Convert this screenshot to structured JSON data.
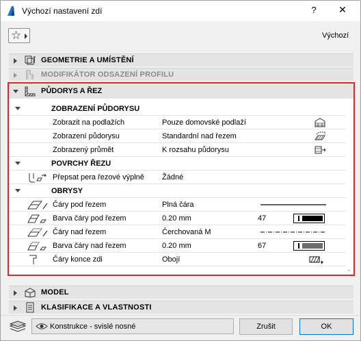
{
  "window": {
    "title": "Výchozí nastavení zdí",
    "help_label": "?",
    "close_label": "✕",
    "default_label": "Výchozí"
  },
  "panels": {
    "geometry": "GEOMETRIE A UMÍSTĚNÍ",
    "offset": "MODIFIKÁTOR ODSAZENÍ PROFILU",
    "plan_section": "PŮDORYS A ŘEZ",
    "model": "MODEL",
    "classification": "KLASIFIKACE A VLASTNOSTI"
  },
  "groups": {
    "plan_display": "ZOBRAZENÍ PŮDORYSU",
    "cut_surfaces": "POVRCHY ŘEZU",
    "outlines": "OBRYSY"
  },
  "rows": {
    "show_on_stories": {
      "label": "Zobrazit na podlažích",
      "value": "Pouze domovské podlaží"
    },
    "floor_plan_display": {
      "label": "Zobrazení půdorysu",
      "value": "Standardní nad řezem"
    },
    "show_projection": {
      "label": "Zobrazený průmět",
      "value": "K rozsahu půdorysu"
    },
    "override_cut_fill": {
      "label": "Přepsat pera řezové výplně",
      "value": "Žádné"
    },
    "uncut_lines": {
      "label": "Čáry pod řezem",
      "value": "Plná čára"
    },
    "uncut_line_pen": {
      "label": "Barva čáry pod řezem",
      "value": "0.20 mm",
      "pen": "47",
      "pen_color": "#000000"
    },
    "overhead_lines": {
      "label": "Čáry nad řezem",
      "value": "Čerchovaná M"
    },
    "overhead_line_pen": {
      "label": "Barva čáry nad řezem",
      "value": "0.20 mm",
      "pen": "67",
      "pen_color": "#6b6b6b"
    },
    "wall_end_lines": {
      "label": "Čáry konce zdi",
      "value": "Obojí"
    }
  },
  "footer": {
    "layer": "Konstrukce - svislé nosné",
    "cancel_label": "Zrušit",
    "ok_label": "OK"
  },
  "colors": {
    "highlight_frame": "#e0242b",
    "ok_border": "#0078d7"
  }
}
